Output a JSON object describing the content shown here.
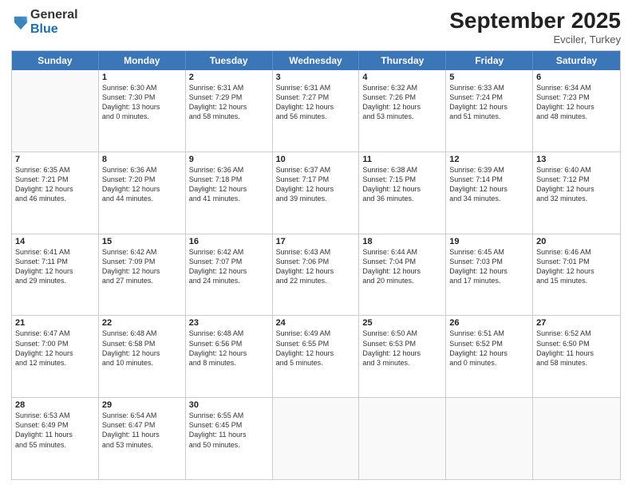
{
  "logo": {
    "general": "General",
    "blue": "Blue"
  },
  "title": "September 2025",
  "subtitle": "Evciler, Turkey",
  "days": [
    "Sunday",
    "Monday",
    "Tuesday",
    "Wednesday",
    "Thursday",
    "Friday",
    "Saturday"
  ],
  "rows": [
    [
      {
        "day": "",
        "lines": []
      },
      {
        "day": "1",
        "lines": [
          "Sunrise: 6:30 AM",
          "Sunset: 7:30 PM",
          "Daylight: 13 hours",
          "and 0 minutes."
        ]
      },
      {
        "day": "2",
        "lines": [
          "Sunrise: 6:31 AM",
          "Sunset: 7:29 PM",
          "Daylight: 12 hours",
          "and 58 minutes."
        ]
      },
      {
        "day": "3",
        "lines": [
          "Sunrise: 6:31 AM",
          "Sunset: 7:27 PM",
          "Daylight: 12 hours",
          "and 56 minutes."
        ]
      },
      {
        "day": "4",
        "lines": [
          "Sunrise: 6:32 AM",
          "Sunset: 7:26 PM",
          "Daylight: 12 hours",
          "and 53 minutes."
        ]
      },
      {
        "day": "5",
        "lines": [
          "Sunrise: 6:33 AM",
          "Sunset: 7:24 PM",
          "Daylight: 12 hours",
          "and 51 minutes."
        ]
      },
      {
        "day": "6",
        "lines": [
          "Sunrise: 6:34 AM",
          "Sunset: 7:23 PM",
          "Daylight: 12 hours",
          "and 48 minutes."
        ]
      }
    ],
    [
      {
        "day": "7",
        "lines": [
          "Sunrise: 6:35 AM",
          "Sunset: 7:21 PM",
          "Daylight: 12 hours",
          "and 46 minutes."
        ]
      },
      {
        "day": "8",
        "lines": [
          "Sunrise: 6:36 AM",
          "Sunset: 7:20 PM",
          "Daylight: 12 hours",
          "and 44 minutes."
        ]
      },
      {
        "day": "9",
        "lines": [
          "Sunrise: 6:36 AM",
          "Sunset: 7:18 PM",
          "Daylight: 12 hours",
          "and 41 minutes."
        ]
      },
      {
        "day": "10",
        "lines": [
          "Sunrise: 6:37 AM",
          "Sunset: 7:17 PM",
          "Daylight: 12 hours",
          "and 39 minutes."
        ]
      },
      {
        "day": "11",
        "lines": [
          "Sunrise: 6:38 AM",
          "Sunset: 7:15 PM",
          "Daylight: 12 hours",
          "and 36 minutes."
        ]
      },
      {
        "day": "12",
        "lines": [
          "Sunrise: 6:39 AM",
          "Sunset: 7:14 PM",
          "Daylight: 12 hours",
          "and 34 minutes."
        ]
      },
      {
        "day": "13",
        "lines": [
          "Sunrise: 6:40 AM",
          "Sunset: 7:12 PM",
          "Daylight: 12 hours",
          "and 32 minutes."
        ]
      }
    ],
    [
      {
        "day": "14",
        "lines": [
          "Sunrise: 6:41 AM",
          "Sunset: 7:11 PM",
          "Daylight: 12 hours",
          "and 29 minutes."
        ]
      },
      {
        "day": "15",
        "lines": [
          "Sunrise: 6:42 AM",
          "Sunset: 7:09 PM",
          "Daylight: 12 hours",
          "and 27 minutes."
        ]
      },
      {
        "day": "16",
        "lines": [
          "Sunrise: 6:42 AM",
          "Sunset: 7:07 PM",
          "Daylight: 12 hours",
          "and 24 minutes."
        ]
      },
      {
        "day": "17",
        "lines": [
          "Sunrise: 6:43 AM",
          "Sunset: 7:06 PM",
          "Daylight: 12 hours",
          "and 22 minutes."
        ]
      },
      {
        "day": "18",
        "lines": [
          "Sunrise: 6:44 AM",
          "Sunset: 7:04 PM",
          "Daylight: 12 hours",
          "and 20 minutes."
        ]
      },
      {
        "day": "19",
        "lines": [
          "Sunrise: 6:45 AM",
          "Sunset: 7:03 PM",
          "Daylight: 12 hours",
          "and 17 minutes."
        ]
      },
      {
        "day": "20",
        "lines": [
          "Sunrise: 6:46 AM",
          "Sunset: 7:01 PM",
          "Daylight: 12 hours",
          "and 15 minutes."
        ]
      }
    ],
    [
      {
        "day": "21",
        "lines": [
          "Sunrise: 6:47 AM",
          "Sunset: 7:00 PM",
          "Daylight: 12 hours",
          "and 12 minutes."
        ]
      },
      {
        "day": "22",
        "lines": [
          "Sunrise: 6:48 AM",
          "Sunset: 6:58 PM",
          "Daylight: 12 hours",
          "and 10 minutes."
        ]
      },
      {
        "day": "23",
        "lines": [
          "Sunrise: 6:48 AM",
          "Sunset: 6:56 PM",
          "Daylight: 12 hours",
          "and 8 minutes."
        ]
      },
      {
        "day": "24",
        "lines": [
          "Sunrise: 6:49 AM",
          "Sunset: 6:55 PM",
          "Daylight: 12 hours",
          "and 5 minutes."
        ]
      },
      {
        "day": "25",
        "lines": [
          "Sunrise: 6:50 AM",
          "Sunset: 6:53 PM",
          "Daylight: 12 hours",
          "and 3 minutes."
        ]
      },
      {
        "day": "26",
        "lines": [
          "Sunrise: 6:51 AM",
          "Sunset: 6:52 PM",
          "Daylight: 12 hours",
          "and 0 minutes."
        ]
      },
      {
        "day": "27",
        "lines": [
          "Sunrise: 6:52 AM",
          "Sunset: 6:50 PM",
          "Daylight: 11 hours",
          "and 58 minutes."
        ]
      }
    ],
    [
      {
        "day": "28",
        "lines": [
          "Sunrise: 6:53 AM",
          "Sunset: 6:49 PM",
          "Daylight: 11 hours",
          "and 55 minutes."
        ]
      },
      {
        "day": "29",
        "lines": [
          "Sunrise: 6:54 AM",
          "Sunset: 6:47 PM",
          "Daylight: 11 hours",
          "and 53 minutes."
        ]
      },
      {
        "day": "30",
        "lines": [
          "Sunrise: 6:55 AM",
          "Sunset: 6:45 PM",
          "Daylight: 11 hours",
          "and 50 minutes."
        ]
      },
      {
        "day": "",
        "lines": []
      },
      {
        "day": "",
        "lines": []
      },
      {
        "day": "",
        "lines": []
      },
      {
        "day": "",
        "lines": []
      }
    ]
  ]
}
